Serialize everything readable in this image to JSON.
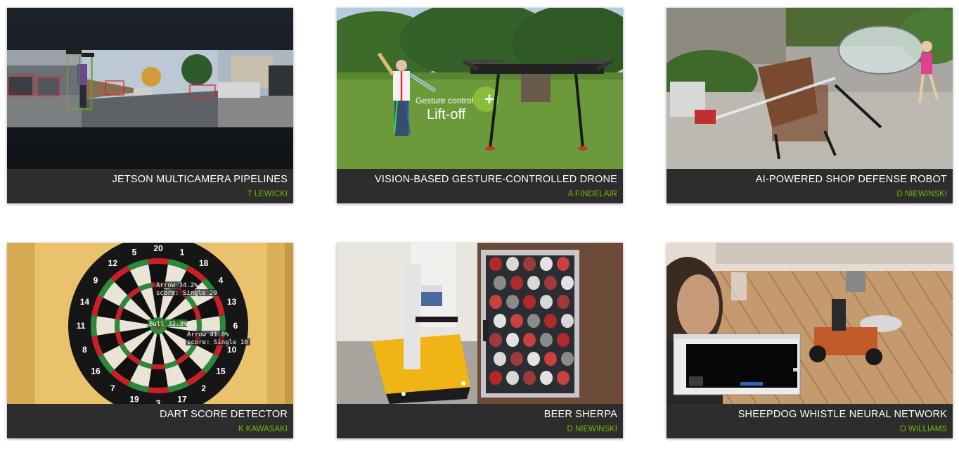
{
  "projects": [
    {
      "title": "JETSON MULTICAMERA PIPELINES",
      "author": "T LEWICKI"
    },
    {
      "title": "VISION-BASED GESTURE-CONTROLLED DRONE",
      "author": "A FINDELAIR"
    },
    {
      "title": "AI-POWERED SHOP DEFENSE ROBOT",
      "author": "D NIEWINSKI"
    },
    {
      "title": "DART SCORE DETECTOR",
      "author": "K KAWASAKI"
    },
    {
      "title": "BEER SHERPA",
      "author": "D NIEWINSKI"
    },
    {
      "title": "SHEEPDOG WHISTLE NEURAL NETWORK",
      "author": "O WILLIAMS"
    }
  ],
  "overlays": {
    "drone_line1": "Gesture control",
    "drone_line2": "Lift-off",
    "dart_arrow1": "Arrow 34.2%",
    "dart_score1": "score: Single 20",
    "dart_bull": "Bull 32.3%",
    "dart_arrow2": "Arrow 41.0%",
    "dart_score2": "score: Single 10",
    "dart_numbers": [
      "20",
      "1",
      "18",
      "4",
      "13",
      "6",
      "10",
      "15",
      "2",
      "17",
      "3",
      "19",
      "7",
      "16",
      "8",
      "11",
      "14",
      "9",
      "12",
      "5"
    ]
  },
  "colors": {
    "caption_bg": "#2d2d2d",
    "title": "#ffffff",
    "author": "#76b900"
  }
}
